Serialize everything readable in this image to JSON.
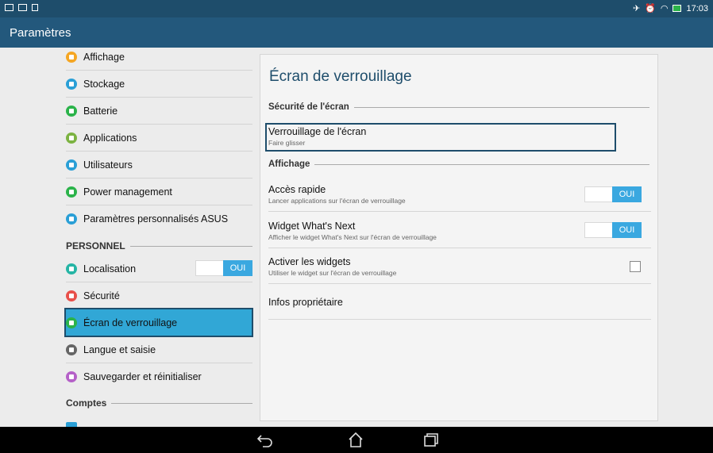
{
  "status": {
    "time": "17:03"
  },
  "app": {
    "title": "Paramètres"
  },
  "sidebar": {
    "items": [
      {
        "label": "Affichage",
        "color": "#f5a623",
        "icon": "display-icon"
      },
      {
        "label": "Stockage",
        "color": "#2a9fd6",
        "icon": "storage-icon"
      },
      {
        "label": "Batterie",
        "color": "#2bb34a",
        "icon": "battery-icon"
      },
      {
        "label": "Applications",
        "color": "#7cb342",
        "icon": "apps-icon"
      },
      {
        "label": "Utilisateurs",
        "color": "#2a9fd6",
        "icon": "users-icon"
      },
      {
        "label": "Power management",
        "color": "#2bb34a",
        "icon": "power-icon"
      },
      {
        "label": "Paramètres personnalisés ASUS",
        "color": "#2a9fd6",
        "icon": "asus-settings-icon"
      },
      {
        "label": "Localisation",
        "color": "#26b5a5",
        "icon": "location-icon",
        "toggle": "OUI"
      },
      {
        "label": "Sécurité",
        "color": "#e8504a",
        "icon": "security-icon"
      },
      {
        "label": "Écran de verrouillage",
        "color": "#2bb34a",
        "icon": "lockscreen-icon"
      },
      {
        "label": "Langue et saisie",
        "color": "#666666",
        "icon": "language-icon"
      },
      {
        "label": "Sauvegarder et réinitialiser",
        "color": "#b561c8",
        "icon": "backup-icon"
      }
    ],
    "sections": [
      "PERSONNEL",
      "Comptes"
    ]
  },
  "panel": {
    "title": "Écran de verrouillage",
    "section1": "Sécurité de l'écran",
    "row_lock": {
      "title": "Verrouillage de l'écran",
      "sub": "Faire glisser"
    },
    "section2": "Affichage",
    "row_quick": {
      "title": "Accès rapide",
      "sub": "Lancer applications sur l'écran de verrouillage",
      "toggle": "OUI"
    },
    "row_widget": {
      "title": "Widget What's Next",
      "sub": "Afficher le widget What's Next sur l'écran de verrouillage",
      "toggle": "OUI"
    },
    "row_widgets": {
      "title": "Activer les widgets",
      "sub": "Utiliser le widget sur l'écran de verrouillage"
    },
    "row_owner": {
      "title": "Infos propriétaire"
    }
  }
}
